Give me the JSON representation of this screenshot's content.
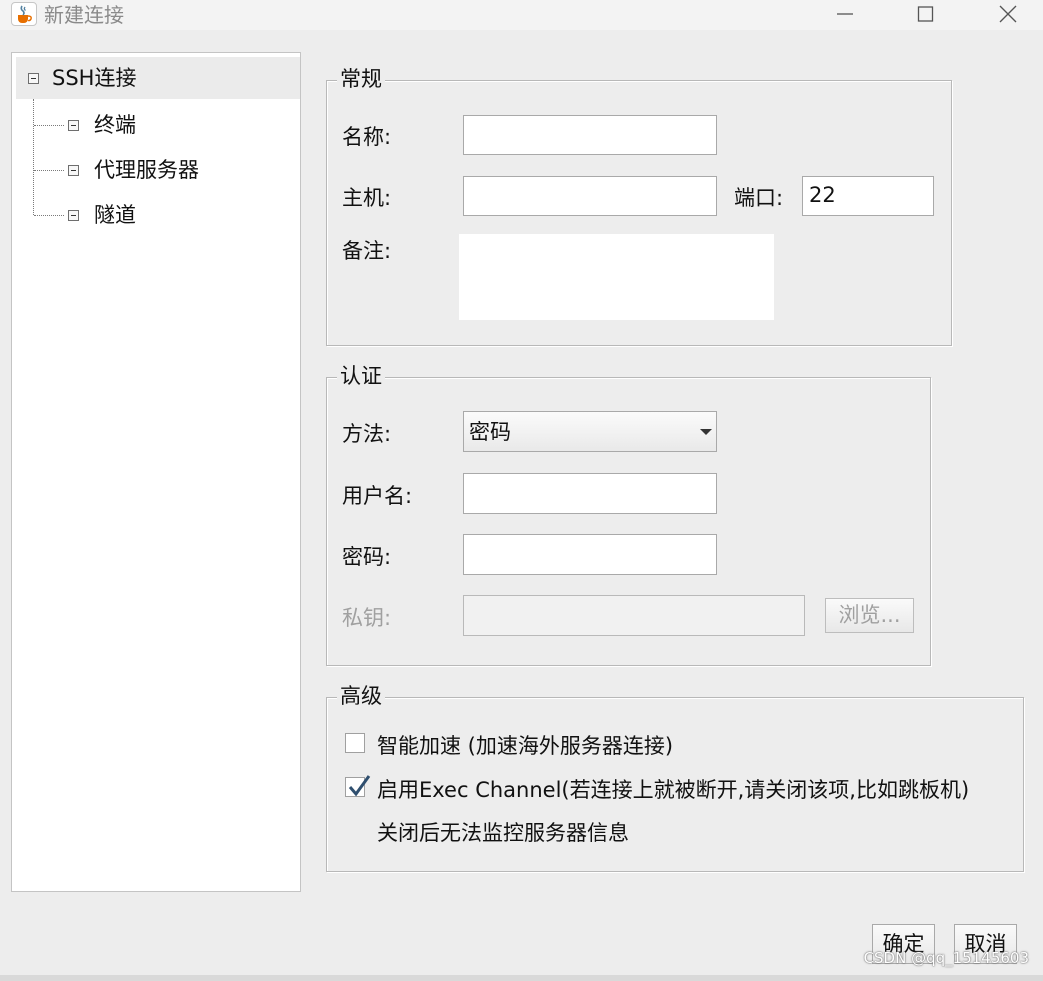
{
  "window": {
    "title": "新建连接",
    "icon": "java-cup-icon"
  },
  "tree": {
    "root": {
      "label": "SSH连接"
    },
    "children": [
      {
        "label": "终端"
      },
      {
        "label": "代理服务器"
      },
      {
        "label": "隧道"
      }
    ]
  },
  "general": {
    "title": "常规",
    "name_label": "名称:",
    "name_value": "",
    "host_label": "主机:",
    "host_value": "",
    "port_label": "端口:",
    "port_value": "22",
    "note_label": "备注:",
    "note_value": ""
  },
  "auth": {
    "title": "认证",
    "method_label": "方法:",
    "method_value": "密码",
    "username_label": "用户名:",
    "username_value": "",
    "password_label": "密码:",
    "password_value": "",
    "key_label": "私钥:",
    "key_value": "",
    "browse_label": "浏览..."
  },
  "advanced": {
    "title": "高级",
    "smart_accel_label": "智能加速 (加速海外服务器连接)",
    "smart_accel_checked": false,
    "exec_channel_label": "启用Exec Channel(若连接上就被断开,请关闭该项,比如跳板机)",
    "exec_channel_checked": true,
    "exec_channel_note": "关闭后无法监控服务器信息"
  },
  "footer": {
    "ok_label": "确定",
    "cancel_label": "取消"
  },
  "watermark": "CSDN @qq_15145603"
}
